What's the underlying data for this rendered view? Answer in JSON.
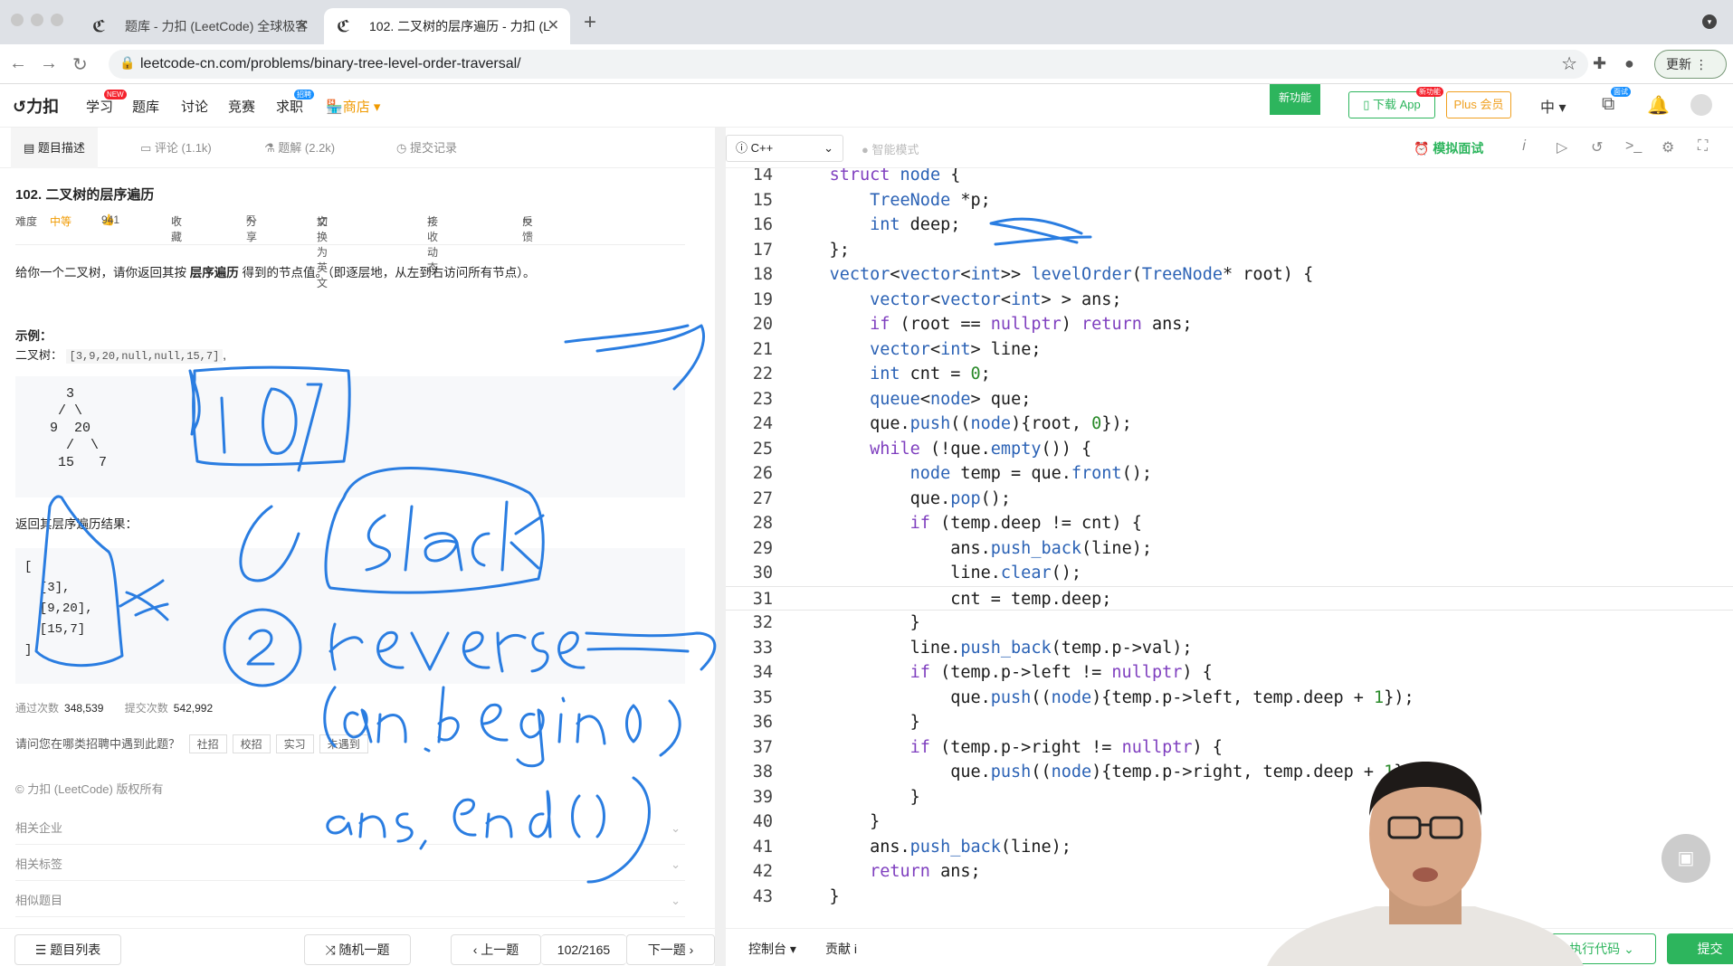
{
  "browser": {
    "tabs": [
      {
        "title": "题库 - 力扣 (LeetCode) 全球极客",
        "active": false
      },
      {
        "title": "102. 二叉树的层序遍历 - 力扣 (L",
        "active": true
      }
    ],
    "url": "leetcode-cn.com/problems/binary-tree-level-order-traversal/",
    "update_label": "更新"
  },
  "lc_nav": {
    "logo": "力扣",
    "items": [
      "学习",
      "题库",
      "讨论",
      "竞赛",
      "求职"
    ],
    "badges": {
      "study": "NEW",
      "jobs": "招聘"
    },
    "shop": "商店",
    "new_feature": "新功能",
    "download_app": "下载 App",
    "download_badge": "新功能",
    "plus": "Plus 会员",
    "language": "中",
    "interview_badge": "面试"
  },
  "left_tabs": [
    "题目描述",
    "评论 (1.1k)",
    "题解 (2.2k)",
    "提交记录"
  ],
  "problem": {
    "title": "102. 二叉树的层序遍历",
    "difficulty_label": "难度",
    "difficulty": "中等",
    "likes": "941",
    "favorite": "收藏",
    "share": "分享",
    "switch_lang": "切换为英文",
    "subscribe": "接收动态",
    "feedback": "反馈",
    "description_pre": "给你一个二叉树，请你返回其按 ",
    "description_bold": "层序遍历",
    "description_post": " 得到的节点值。（即逐层地，从左到右访问所有节点）。",
    "example_label": "示例：",
    "example_prefix": "二叉树：",
    "example_input": "[3,9,20,null,null,15,7]",
    "example_suffix": ",",
    "tree": "    3\n   / \\\n  9  20\n    /  \\\n   15   7",
    "return_label": "返回其层序遍历结果：",
    "result": "[\n  [3],\n  [9,20],\n  [15,7]\n]",
    "accepted_label": "通过次数",
    "accepted": "348,539",
    "submissions_label": "提交次数",
    "submissions": "542,992",
    "question": "请问您在哪类招聘中遇到此题？",
    "tags": [
      "社招",
      "校招",
      "实习",
      "未遇到"
    ],
    "copyright": "© 力扣 (LeetCode) 版权所有",
    "sections": [
      "相关企业",
      "相关标签",
      "相似题目"
    ]
  },
  "left_bottom": {
    "list": "题目列表",
    "random": "随机一题",
    "prev": "上一题",
    "counter": "102/2165",
    "next": "下一题"
  },
  "editor_toolbar": {
    "language": "C++",
    "smart_mode": "智能模式",
    "mock_interview": "模拟面试"
  },
  "code_lines": [
    {
      "n": "14",
      "t": "    struct node {"
    },
    {
      "n": "15",
      "t": "        TreeNode *p;"
    },
    {
      "n": "16",
      "t": "        int deep;"
    },
    {
      "n": "17",
      "t": "    };"
    },
    {
      "n": "18",
      "t": "    vector<vector<int>> levelOrder(TreeNode* root) {"
    },
    {
      "n": "19",
      "t": "        vector<vector<int> > ans;"
    },
    {
      "n": "20",
      "t": "        if (root == nullptr) return ans;"
    },
    {
      "n": "21",
      "t": "        vector<int> line;"
    },
    {
      "n": "22",
      "t": "        int cnt = 0;"
    },
    {
      "n": "23",
      "t": "        queue<node> que;"
    },
    {
      "n": "24",
      "t": "        que.push((node){root, 0});"
    },
    {
      "n": "25",
      "t": "        while (!que.empty()) {"
    },
    {
      "n": "26",
      "t": "            node temp = que.front();"
    },
    {
      "n": "27",
      "t": "            que.pop();"
    },
    {
      "n": "28",
      "t": "            if (temp.deep != cnt) {"
    },
    {
      "n": "29",
      "t": "                ans.push_back(line);"
    },
    {
      "n": "30",
      "t": "                line.clear();"
    },
    {
      "n": "31",
      "t": "                cnt = temp.deep;"
    },
    {
      "n": "32",
      "t": "            }"
    },
    {
      "n": "33",
      "t": "            line.push_back(temp.p->val);"
    },
    {
      "n": "34",
      "t": "            if (temp.p->left != nullptr) {"
    },
    {
      "n": "35",
      "t": "                que.push((node){temp.p->left, temp.deep + 1});"
    },
    {
      "n": "36",
      "t": "            }"
    },
    {
      "n": "37",
      "t": "            if (temp.p->right != nullptr) {"
    },
    {
      "n": "38",
      "t": "                que.push((node){temp.p->right, temp.deep + 1});"
    },
    {
      "n": "39",
      "t": "            }"
    },
    {
      "n": "40",
      "t": "        }"
    },
    {
      "n": "41",
      "t": "        ans.push_back(line);"
    },
    {
      "n": "42",
      "t": "        return ans;"
    },
    {
      "n": "43",
      "t": "    }"
    }
  ],
  "highlighted_line": "31",
  "right_bottom": {
    "console": "控制台",
    "contribute": "贡献 i",
    "run": "执行代码",
    "submit": "提交"
  },
  "annotations": [
    "[0]",
    "① stack",
    "② reverse",
    "(ans.begin()",
    "ans.end())"
  ],
  "colors": {
    "accent_green": "#2db55d",
    "ink_blue": "#2a7de1",
    "medium": "#f09a00"
  }
}
